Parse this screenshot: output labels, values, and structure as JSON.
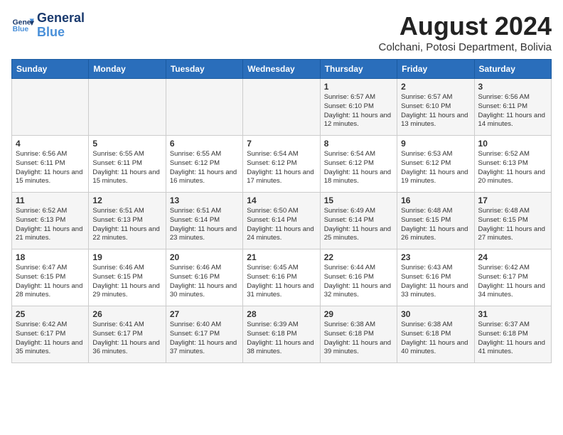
{
  "header": {
    "logo_line1": "General",
    "logo_line2": "Blue",
    "main_title": "August 2024",
    "sub_title": "Colchani, Potosi Department, Bolivia"
  },
  "days_of_week": [
    "Sunday",
    "Monday",
    "Tuesday",
    "Wednesday",
    "Thursday",
    "Friday",
    "Saturday"
  ],
  "weeks": [
    [
      {
        "day": "",
        "content": ""
      },
      {
        "day": "",
        "content": ""
      },
      {
        "day": "",
        "content": ""
      },
      {
        "day": "",
        "content": ""
      },
      {
        "day": "1",
        "content": "Sunrise: 6:57 AM\nSunset: 6:10 PM\nDaylight: 11 hours\nand 12 minutes."
      },
      {
        "day": "2",
        "content": "Sunrise: 6:57 AM\nSunset: 6:10 PM\nDaylight: 11 hours\nand 13 minutes."
      },
      {
        "day": "3",
        "content": "Sunrise: 6:56 AM\nSunset: 6:11 PM\nDaylight: 11 hours\nand 14 minutes."
      }
    ],
    [
      {
        "day": "4",
        "content": "Sunrise: 6:56 AM\nSunset: 6:11 PM\nDaylight: 11 hours\nand 15 minutes."
      },
      {
        "day": "5",
        "content": "Sunrise: 6:55 AM\nSunset: 6:11 PM\nDaylight: 11 hours\nand 15 minutes."
      },
      {
        "day": "6",
        "content": "Sunrise: 6:55 AM\nSunset: 6:12 PM\nDaylight: 11 hours\nand 16 minutes."
      },
      {
        "day": "7",
        "content": "Sunrise: 6:54 AM\nSunset: 6:12 PM\nDaylight: 11 hours\nand 17 minutes."
      },
      {
        "day": "8",
        "content": "Sunrise: 6:54 AM\nSunset: 6:12 PM\nDaylight: 11 hours\nand 18 minutes."
      },
      {
        "day": "9",
        "content": "Sunrise: 6:53 AM\nSunset: 6:12 PM\nDaylight: 11 hours\nand 19 minutes."
      },
      {
        "day": "10",
        "content": "Sunrise: 6:52 AM\nSunset: 6:13 PM\nDaylight: 11 hours\nand 20 minutes."
      }
    ],
    [
      {
        "day": "11",
        "content": "Sunrise: 6:52 AM\nSunset: 6:13 PM\nDaylight: 11 hours\nand 21 minutes."
      },
      {
        "day": "12",
        "content": "Sunrise: 6:51 AM\nSunset: 6:13 PM\nDaylight: 11 hours\nand 22 minutes."
      },
      {
        "day": "13",
        "content": "Sunrise: 6:51 AM\nSunset: 6:14 PM\nDaylight: 11 hours\nand 23 minutes."
      },
      {
        "day": "14",
        "content": "Sunrise: 6:50 AM\nSunset: 6:14 PM\nDaylight: 11 hours\nand 24 minutes."
      },
      {
        "day": "15",
        "content": "Sunrise: 6:49 AM\nSunset: 6:14 PM\nDaylight: 11 hours\nand 25 minutes."
      },
      {
        "day": "16",
        "content": "Sunrise: 6:48 AM\nSunset: 6:15 PM\nDaylight: 11 hours\nand 26 minutes."
      },
      {
        "day": "17",
        "content": "Sunrise: 6:48 AM\nSunset: 6:15 PM\nDaylight: 11 hours\nand 27 minutes."
      }
    ],
    [
      {
        "day": "18",
        "content": "Sunrise: 6:47 AM\nSunset: 6:15 PM\nDaylight: 11 hours\nand 28 minutes."
      },
      {
        "day": "19",
        "content": "Sunrise: 6:46 AM\nSunset: 6:15 PM\nDaylight: 11 hours\nand 29 minutes."
      },
      {
        "day": "20",
        "content": "Sunrise: 6:46 AM\nSunset: 6:16 PM\nDaylight: 11 hours\nand 30 minutes."
      },
      {
        "day": "21",
        "content": "Sunrise: 6:45 AM\nSunset: 6:16 PM\nDaylight: 11 hours\nand 31 minutes."
      },
      {
        "day": "22",
        "content": "Sunrise: 6:44 AM\nSunset: 6:16 PM\nDaylight: 11 hours\nand 32 minutes."
      },
      {
        "day": "23",
        "content": "Sunrise: 6:43 AM\nSunset: 6:16 PM\nDaylight: 11 hours\nand 33 minutes."
      },
      {
        "day": "24",
        "content": "Sunrise: 6:42 AM\nSunset: 6:17 PM\nDaylight: 11 hours\nand 34 minutes."
      }
    ],
    [
      {
        "day": "25",
        "content": "Sunrise: 6:42 AM\nSunset: 6:17 PM\nDaylight: 11 hours\nand 35 minutes."
      },
      {
        "day": "26",
        "content": "Sunrise: 6:41 AM\nSunset: 6:17 PM\nDaylight: 11 hours\nand 36 minutes."
      },
      {
        "day": "27",
        "content": "Sunrise: 6:40 AM\nSunset: 6:17 PM\nDaylight: 11 hours\nand 37 minutes."
      },
      {
        "day": "28",
        "content": "Sunrise: 6:39 AM\nSunset: 6:18 PM\nDaylight: 11 hours\nand 38 minutes."
      },
      {
        "day": "29",
        "content": "Sunrise: 6:38 AM\nSunset: 6:18 PM\nDaylight: 11 hours\nand 39 minutes."
      },
      {
        "day": "30",
        "content": "Sunrise: 6:38 AM\nSunset: 6:18 PM\nDaylight: 11 hours\nand 40 minutes."
      },
      {
        "day": "31",
        "content": "Sunrise: 6:37 AM\nSunset: 6:18 PM\nDaylight: 11 hours\nand 41 minutes."
      }
    ]
  ]
}
